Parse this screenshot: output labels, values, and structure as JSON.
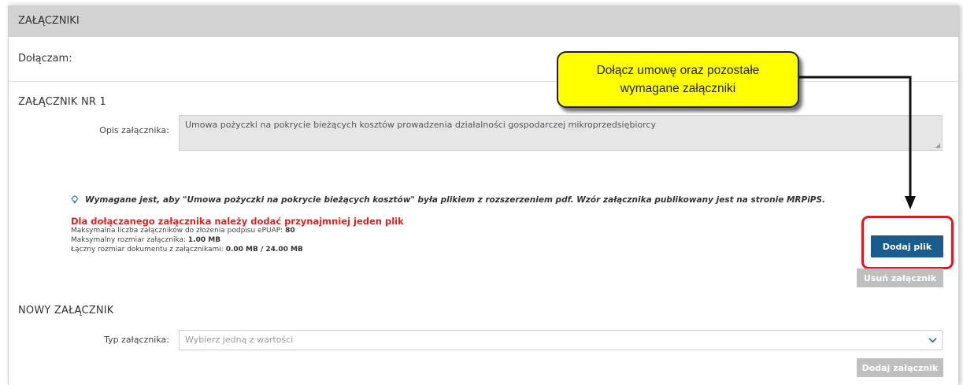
{
  "section": {
    "title": "ZAŁĄCZNIKI"
  },
  "attach_row": {
    "label": "Dołączam:"
  },
  "attachment1": {
    "heading": "ZAŁĄCZNIK NR 1",
    "description_label": "Opis załącznika:",
    "description_value": "Umowa pożyczki na pokrycie bieżących kosztów prowadzenia działalności gospodarczej mikroprzedsiębiorcy",
    "info_text": "Wymagane jest, aby \"Umowa pożyczki na pokrycie bieżących kosztów\" była plikiem z rozszerzeniem pdf. Wzór załącznika publikowany jest na stronie MRPiPS.",
    "warning": "Dla dołączanego załącznika należy dodać przynajmniej jeden plik",
    "meta": [
      {
        "label": "Maksymalna liczba załączników do złożenia podpisu ePUAP: ",
        "value": "80"
      },
      {
        "label": "Maksymalny rozmiar załącznika: ",
        "value": "1.00 MB"
      },
      {
        "label": "Łączny rozmiar dokumentu z załącznikami: ",
        "value": "0.00 MB / 24.00 MB"
      }
    ],
    "add_file_label": "Dodaj plik",
    "remove_label": "Usuń załącznik"
  },
  "new_attachment": {
    "heading": "NOWY ZAŁĄCZNIK",
    "type_label": "Typ załącznika:",
    "type_placeholder": "Wybierz jedną z wartości",
    "add_label": "Dodaj załącznik"
  },
  "callout": {
    "line1": "Dołącz umowę oraz pozostałe",
    "line2": "wymagane załączniki"
  },
  "colors": {
    "primary_button": "#1a5c8c",
    "warning_text": "#e02020",
    "callout_fill": "#ffff00",
    "highlight_outline": "#e0181f",
    "disabled_button": "#bfbfbf"
  },
  "icons": {
    "info": "lightbulb-icon",
    "select_arrow": "chevron-down-icon",
    "callout_arrow": "arrow-down-icon"
  }
}
